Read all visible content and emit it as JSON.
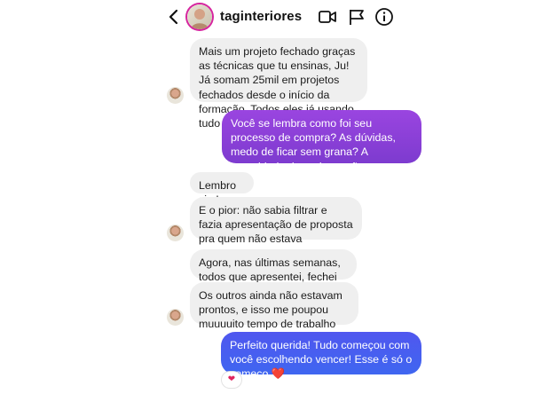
{
  "header": {
    "username": "taginteriores",
    "icons": [
      "back-chevron-icon",
      "video-call-icon",
      "flag-icon",
      "info-icon"
    ]
  },
  "messages": [
    {
      "side": "in",
      "text": "Mais um projeto fechado graças as técnicas que tu ensinas, Ju! Já somam 25mil em projetos fechados desde o início da formação. Todos eles já usando tudo que aprendi!"
    },
    {
      "side": "out",
      "text": "Você se lembra como foi seu processo de compra? As dúvidas, medo de ficar sem grana? A quantidade de projetos não fechados?"
    },
    {
      "side": "in",
      "text": "Lembro sim!"
    },
    {
      "side": "in",
      "text": "E o pior: não sabia filtrar e fazia apresentação de proposta pra quem não estava preparado"
    },
    {
      "side": "in",
      "text": "Agora, nas últimas semanas, todos que apresentei, fechei"
    },
    {
      "side": "in",
      "text": "Os outros ainda não estavam prontos, e isso me poupou muuuuito tempo de trabalho"
    },
    {
      "side": "out",
      "text": "Perfeito querida! Tudo começou com você escolhendo vencer! Esse é só o começo ❤️"
    }
  ],
  "reaction": "❤",
  "colors": {
    "incoming_bubble": "#efefef",
    "outgoing_purple": "#8b3fd9",
    "outgoing_blue": "#3f63f0",
    "story_ring": "#d6249f"
  }
}
